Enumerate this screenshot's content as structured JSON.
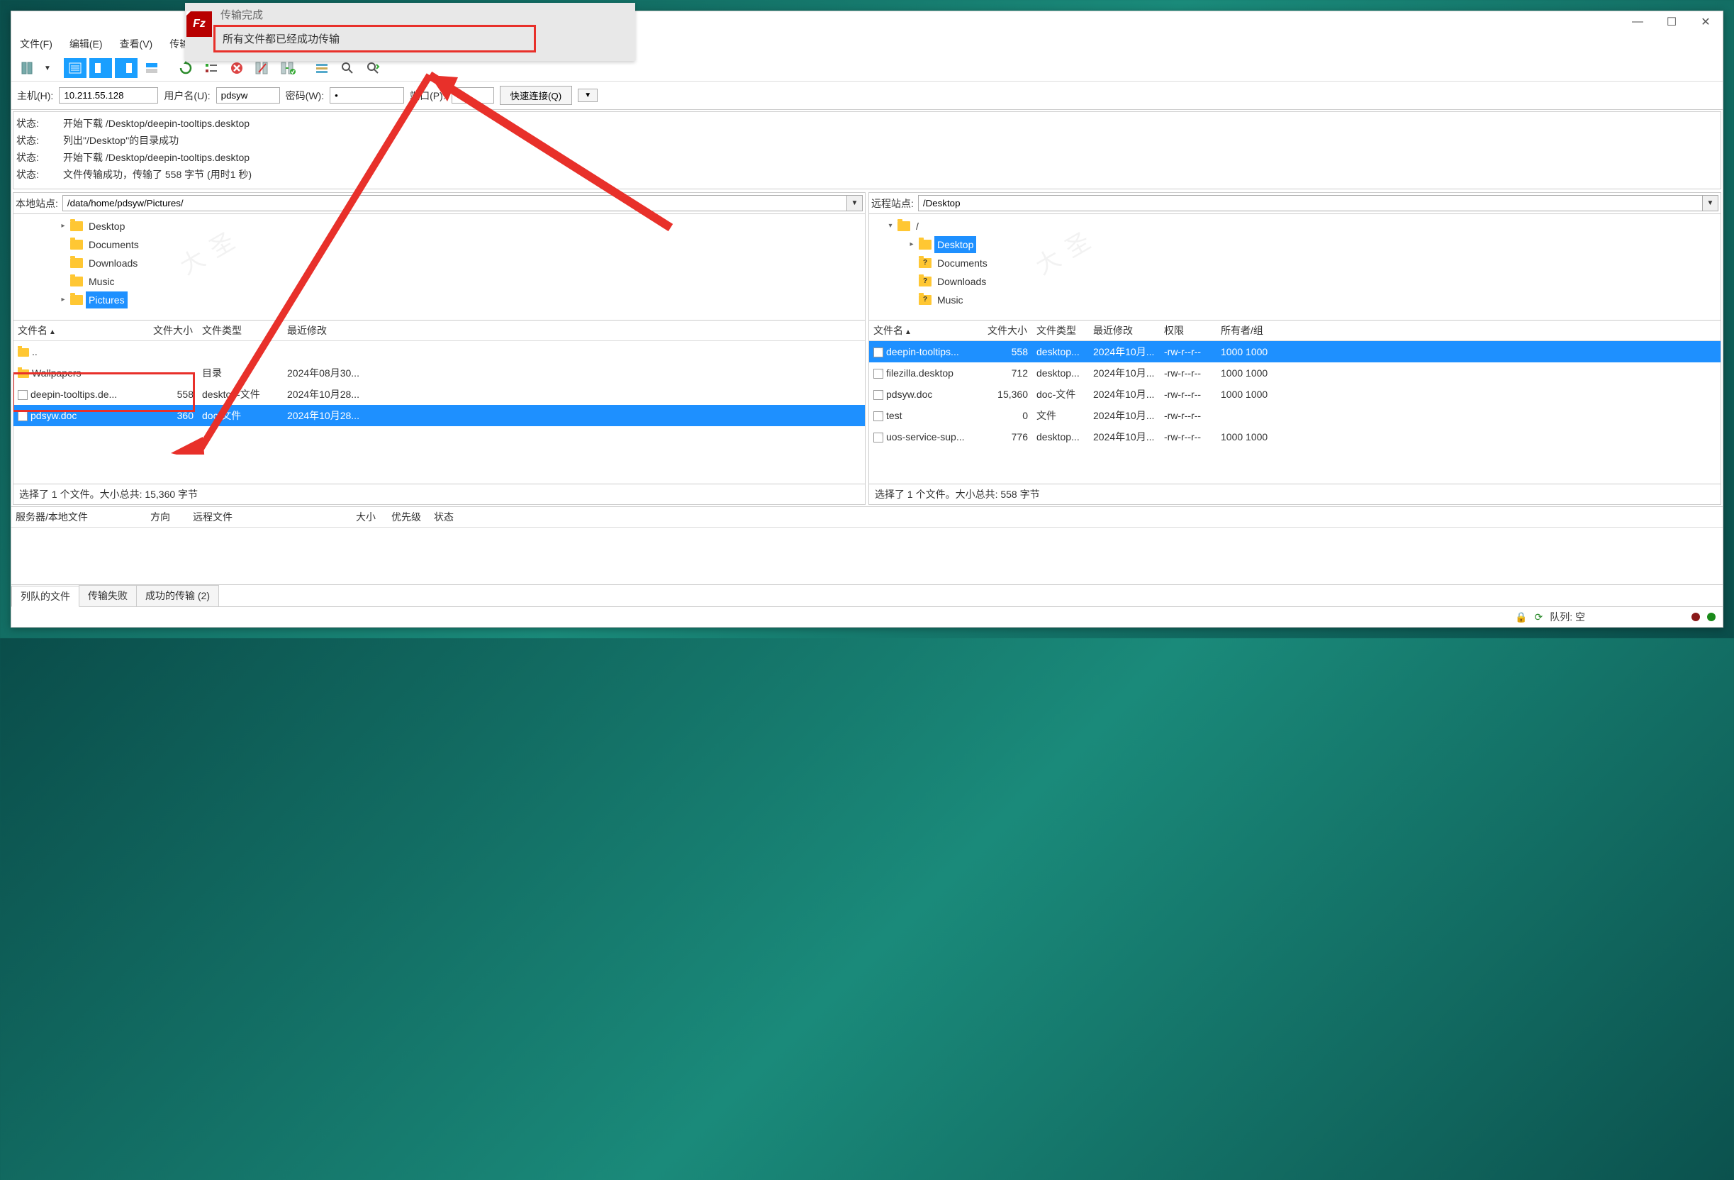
{
  "titlebar": {
    "min": "—",
    "max": "☐",
    "close": "✕"
  },
  "notification": {
    "title": "传输完成",
    "message": "所有文件都已经成功传输"
  },
  "menu": {
    "file": "文件(F)",
    "edit": "编辑(E)",
    "view": "查看(V)",
    "transfer": "传输(T)"
  },
  "quickconnect": {
    "host_label": "主机(H):",
    "host_value": "10.211.55.128",
    "user_label": "用户名(U):",
    "user_value": "pdsyw",
    "pass_label": "密码(W):",
    "pass_value": "●",
    "port_label": "端口(P):",
    "port_value": "",
    "btn": "快速连接(Q)"
  },
  "log": {
    "label": "状态:",
    "l1": "开始下载 /Desktop/deepin-tooltips.desktop",
    "l2": "列出\"/Desktop\"的目录成功",
    "l3": "开始下载 /Desktop/deepin-tooltips.desktop",
    "l4": "文件传输成功，传输了 558 字节 (用时1 秒)"
  },
  "local": {
    "site_label": "本地站点:",
    "path": "/data/home/pdsyw/Pictures/",
    "tree": {
      "desktop": "Desktop",
      "documents": "Documents",
      "downloads": "Downloads",
      "music": "Music",
      "pictures": "Pictures"
    },
    "cols": {
      "name": "文件名",
      "size": "文件大小",
      "type": "文件类型",
      "date": "最近修改"
    },
    "rows": {
      "up": "..",
      "wallpapers": {
        "name": "Wallpapers",
        "size": "",
        "type": "目录",
        "date": "2024年08月30..."
      },
      "deepin": {
        "name": "deepin-tooltips.de...",
        "size": "558",
        "type": "desktop-文件",
        "date": "2024年10月28..."
      },
      "pdsyw": {
        "name": "pdsyw.doc",
        "size": "360",
        "type": "doc-文件",
        "date": "2024年10月28..."
      }
    },
    "status": "选择了 1 个文件。大小总共: 15,360 字节"
  },
  "remote": {
    "site_label": "远程站点:",
    "path": "/Desktop",
    "tree": {
      "root": "/",
      "desktop": "Desktop",
      "documents": "Documents",
      "downloads": "Downloads",
      "music": "Music"
    },
    "cols": {
      "name": "文件名",
      "size": "文件大小",
      "type": "文件类型",
      "date": "最近修改",
      "perm": "权限",
      "owner": "所有者/组"
    },
    "rows": {
      "deepin": {
        "name": "deepin-tooltips...",
        "size": "558",
        "type": "desktop...",
        "date": "2024年10月...",
        "perm": "-rw-r--r--",
        "owner": "1000 1000"
      },
      "filezilla": {
        "name": "filezilla.desktop",
        "size": "712",
        "type": "desktop...",
        "date": "2024年10月...",
        "perm": "-rw-r--r--",
        "owner": "1000 1000"
      },
      "pdsyw": {
        "name": "pdsyw.doc",
        "size": "15,360",
        "type": "doc-文件",
        "date": "2024年10月...",
        "perm": "-rw-r--r--",
        "owner": "1000 1000"
      },
      "test": {
        "name": "test",
        "size": "0",
        "type": "文件",
        "date": "2024年10月...",
        "perm": "-rw-r--r--",
        "owner": ""
      },
      "uos": {
        "name": "uos-service-sup...",
        "size": "776",
        "type": "desktop...",
        "date": "2024年10月...",
        "perm": "-rw-r--r--",
        "owner": "1000 1000"
      }
    },
    "status": "选择了 1 个文件。大小总共: 558 字节"
  },
  "transfer": {
    "server": "服务器/本地文件",
    "dir": "方向",
    "remote": "远程文件",
    "size": "大小",
    "prio": "优先级",
    "status": "状态"
  },
  "tabs": {
    "queued": "列队的文件",
    "failed": "传输失败",
    "success": "成功的传输 (2)"
  },
  "statusbar": {
    "queue": "队列: 空"
  },
  "watermark": "大圣"
}
